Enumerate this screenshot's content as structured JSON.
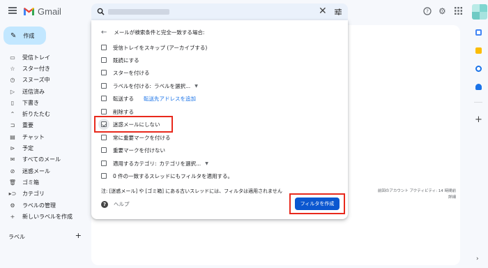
{
  "app": {
    "name": "Gmail"
  },
  "compose": {
    "label": "作成"
  },
  "sidebar": {
    "items": [
      {
        "label": "受信トレイ",
        "icon": "inbox-icon"
      },
      {
        "label": "スター付き",
        "icon": "star-icon"
      },
      {
        "label": "スヌーズ中",
        "icon": "clock-icon"
      },
      {
        "label": "送信済み",
        "icon": "send-icon"
      },
      {
        "label": "下書き",
        "icon": "draft-icon"
      },
      {
        "label": "折りたたむ",
        "icon": "chevron-up-icon"
      },
      {
        "label": "重要",
        "icon": "important-icon"
      },
      {
        "label": "チャット",
        "icon": "chat-icon"
      },
      {
        "label": "予定",
        "icon": "scheduled-icon"
      },
      {
        "label": "すべてのメール",
        "icon": "all-mail-icon"
      },
      {
        "label": "迷惑メール",
        "icon": "spam-icon"
      },
      {
        "label": "ゴミ箱",
        "icon": "trash-icon"
      },
      {
        "label": "カテゴリ",
        "icon": "category-icon"
      },
      {
        "label": "ラベルの管理",
        "icon": "gear-icon"
      },
      {
        "label": "新しいラベルを作成",
        "icon": "plus-icon"
      }
    ],
    "labels_header": "ラベル",
    "labels_add": "+"
  },
  "search": {
    "clear": "✕"
  },
  "filter": {
    "header": "メールが検索条件と完全一致する場合:",
    "options": [
      {
        "label": "受信トレイをスキップ (アーカイブする)",
        "checked": false
      },
      {
        "label": "既読にする",
        "checked": false
      },
      {
        "label": "スターを付ける",
        "checked": false
      },
      {
        "label": "ラベルを付ける:",
        "select": "ラベルを選択...",
        "checked": false
      },
      {
        "label": "転送する",
        "link": "転送先アドレスを追加",
        "checked": false
      },
      {
        "label": "削除する",
        "checked": false
      },
      {
        "label": "迷惑メールにしない",
        "checked": true
      },
      {
        "label": "常に重要マークを付ける",
        "checked": false
      },
      {
        "label": "重要マークを付けない",
        "checked": false
      },
      {
        "label": "適用するカテゴリ:",
        "select": "カテゴリを選択...",
        "checked": false
      },
      {
        "label": "0 件の一致するスレッドにもフィルタを適用する。",
        "checked": false
      }
    ],
    "notice": "注: [迷惑メール] や [ゴミ箱] にある古いスレッドには、フィルタは適用されません",
    "help": "ヘルプ",
    "create_button": "フィルタを作成"
  },
  "activity": {
    "line1": "前回のアカウント アクティビティ: 14 時間前",
    "line2": "詳細"
  },
  "colors": {
    "accent": "#0b57d0",
    "highlight": "#e8291c",
    "compose_bg": "#c2e7ff"
  }
}
